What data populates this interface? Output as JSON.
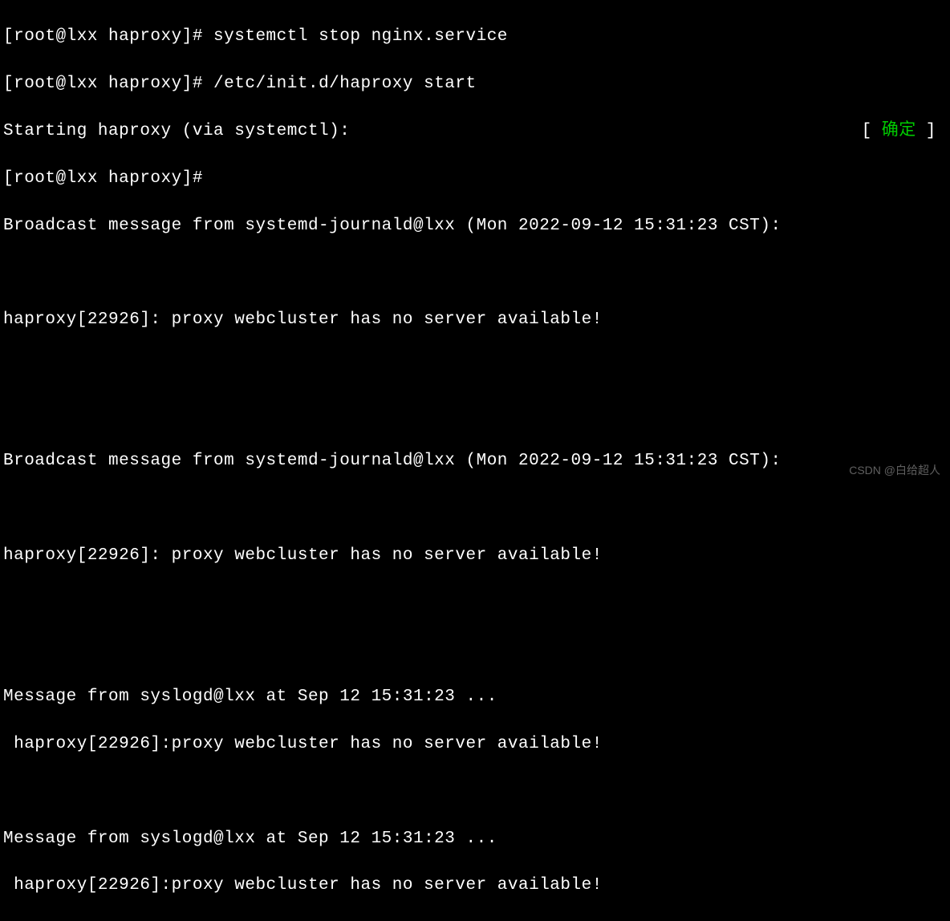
{
  "lines": {
    "l1_prompt": "[root@lxx haproxy]# ",
    "l1_cmd": "systemctl stop nginx.service",
    "l2_prompt": "[root@lxx haproxy]# ",
    "l2_cmd": "/etc/init.d/haproxy start",
    "l3_left": "Starting haproxy (via systemctl):",
    "l3_bracket_open": "[",
    "l3_status": "确定",
    "l3_bracket_close": "]",
    "l4_prompt": "[root@lxx haproxy]#",
    "l5": "Broadcast message from systemd-journald@lxx (Mon 2022-09-12 15:31:23 CST):",
    "l6": "",
    "l7": "haproxy[22926]: proxy webcluster has no server available!",
    "l8": "",
    "l9": "",
    "l10": "Broadcast message from systemd-journald@lxx (Mon 2022-09-12 15:31:23 CST):",
    "l11": "",
    "l12": "haproxy[22926]: proxy webcluster has no server available!",
    "l13": "",
    "l14": "",
    "l15": "Message from syslogd@lxx at Sep 12 15:31:23 ...",
    "l16": " haproxy[22926]:proxy webcluster has no server available!",
    "l17": "",
    "l18": "Message from syslogd@lxx at Sep 12 15:31:23 ...",
    "l19": " haproxy[22926]:proxy webcluster has no server available!"
  },
  "watermark": "CSDN @白给超人"
}
